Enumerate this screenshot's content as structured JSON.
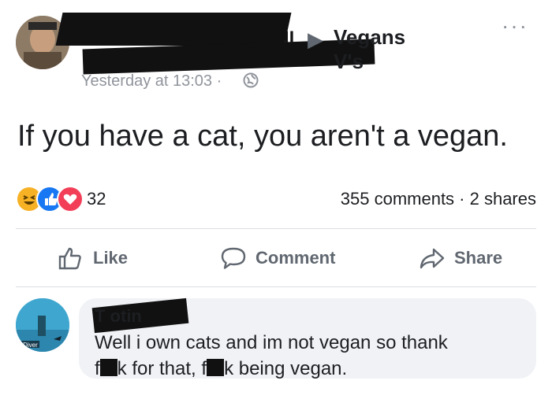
{
  "post": {
    "author_tail": "ll",
    "group_name": "Vegans V's",
    "timestamp": "Yesterday at 13:03 ·",
    "more_label": "···",
    "text": "If you have a cat, you aren't a vegan.",
    "reaction_count": "32",
    "stats": "355 comments · 2 shares"
  },
  "actions": {
    "like": "Like",
    "comment": "Comment",
    "share": "Share"
  },
  "comment": {
    "author": "T        otin",
    "text_part1": "Well i own cats and im not vegan so thank",
    "text_f1": "f",
    "text_mid": "k for that, f",
    "text_end": "k being vegan.",
    "avatar_label": "A Diver"
  },
  "colors": {
    "like_blue": "#1877f2",
    "love_red": "#f33e58",
    "haha_yellow": "#f7b125",
    "muted_text": "#606770",
    "bubble_bg": "#f0f2f5"
  }
}
